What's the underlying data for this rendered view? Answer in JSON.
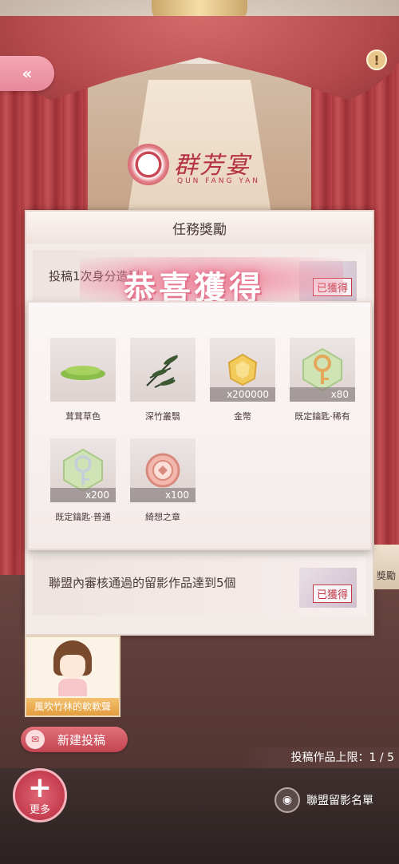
{
  "top": {
    "back_icon": "double-chevron-left-icon",
    "info_icon": "exclamation-icon"
  },
  "logo": {
    "title": "群芳宴",
    "subtitle": "QUN FANG YAN"
  },
  "panel": {
    "title": "任務獎勵",
    "tasks": [
      {
        "text": "投稿1次身分造型",
        "status": "已獲得"
      },
      {
        "text": "聯盟內審核通過的留影作品達到5個",
        "status": "已獲得"
      }
    ]
  },
  "congrats": {
    "title": "恭喜獲得",
    "rewards": [
      {
        "name": "茸茸草色",
        "qty": "",
        "icon": "grass-icon"
      },
      {
        "name": "深竹叢翳",
        "qty": "",
        "icon": "bamboo-icon"
      },
      {
        "name": "金幣",
        "qty": "x200000",
        "icon": "gold-coin-icon"
      },
      {
        "name": "既定鑰匙·稀有",
        "qty": "x80",
        "icon": "rare-key-icon"
      },
      {
        "name": "既定鑰匙·普通",
        "qty": "x200",
        "icon": "common-key-icon"
      },
      {
        "name": "綺想之章",
        "qty": "x100",
        "icon": "badge-icon"
      }
    ]
  },
  "side_reward_label": "獎勵",
  "submission": {
    "title": "風吹竹林的軟軟聲"
  },
  "actions": {
    "new_submit": "新建投稿",
    "limit": "投稿作品上限：1 / 5",
    "more": "更多",
    "alliance_list": "聯盟留影名單"
  }
}
